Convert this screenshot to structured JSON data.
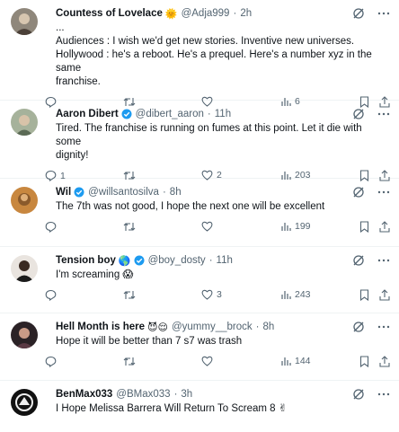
{
  "tweets": [
    {
      "name": "Countess of Lovelace",
      "name_emoji": "🌞",
      "handle": "@Adja999",
      "time": "2h",
      "lines": [
        "...",
        "Audiences : I wish we'd get new stories. Inventive new universes.",
        "Hollywood : he's a reboot. He's a prequel. Here's a number xyz in the same",
        "franchise."
      ],
      "replies": "",
      "retweets": "",
      "likes": "",
      "views": "6",
      "verified": false,
      "avatar_color": "#6b6257"
    },
    {
      "name": "Aaron Dibert",
      "name_emoji": "",
      "handle": "@dibert_aaron",
      "time": "11h",
      "lines": [
        "Tired. The franchise is running on fumes at this point. Let it die with some",
        "dignity!"
      ],
      "replies": "1",
      "retweets": "",
      "likes": "2",
      "views": "203",
      "verified": true,
      "avatar_color": "#9aa590"
    },
    {
      "name": "Wil",
      "name_emoji": "",
      "handle": "@willsantosilva",
      "time": "8h",
      "lines": [
        "The 7th was not good, I hope the next one will be excellent"
      ],
      "replies": "",
      "retweets": "",
      "likes": "",
      "views": "199",
      "verified": true,
      "avatar_color": "#b77a3d"
    },
    {
      "name": "Tension boy",
      "name_emoji": "🌎",
      "handle": "@boy_dosty",
      "time": "11h",
      "lines": [
        "I'm screaming 😱"
      ],
      "replies": "",
      "retweets": "",
      "likes": "3",
      "views": "243",
      "verified": true,
      "avatar_color": "#2a2a2a"
    },
    {
      "name": "Hell Month is here",
      "name_emoji": "😈😌",
      "handle": "@yummy__brock",
      "time": "8h",
      "lines": [
        "Hope it will be better than 7 s7 was trash"
      ],
      "replies": "",
      "retweets": "",
      "likes": "",
      "views": "144",
      "verified": false,
      "avatar_color": "#3a2a2e"
    },
    {
      "name": "BenMax033",
      "name_emoji": "",
      "handle": "@BMax033",
      "time": "3h",
      "lines": [
        "I Hope Melissa Barrera Will Return To Scream 8 ✌"
      ],
      "replies": "",
      "retweets": "",
      "likes": "",
      "views": "",
      "verified": false,
      "avatar_color": "#111111"
    }
  ],
  "colors": {
    "text": "#0f1419",
    "secondary": "#536471",
    "verified": "#1d9bf0",
    "divider": "#eff3f4"
  },
  "icons": [
    "grok-icon",
    "more-icon",
    "reply-icon",
    "retweet-icon",
    "like-icon",
    "views-icon",
    "bookmark-icon",
    "share-icon",
    "verified-badge-icon"
  ]
}
